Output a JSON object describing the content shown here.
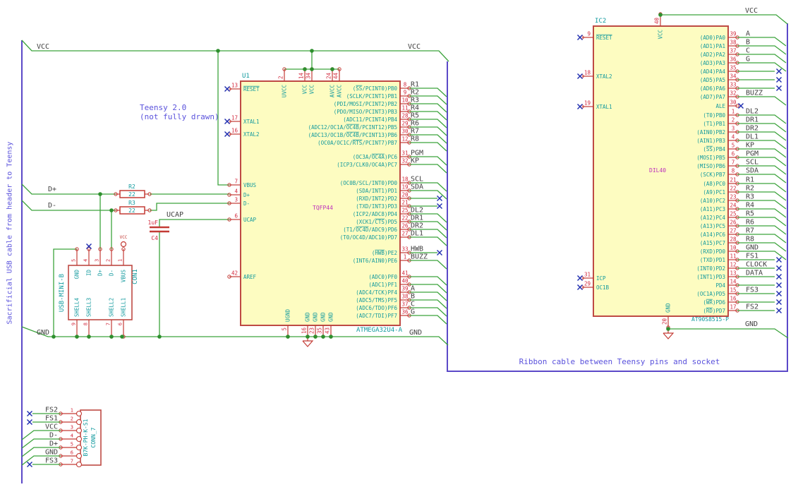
{
  "notes": {
    "cable": "Sacrificial USB cable from header to Teensy",
    "teensy1": "Teensy 2.0",
    "teensy2": "(not fully drawn)",
    "ribbon": "Ribbon cable between Teensy pins and socket"
  },
  "colors": {
    "wire": "#3ca33c",
    "junction": "#2e8f2e",
    "device": "#be4a44",
    "device_fill": "#fdfcc1",
    "pin": "#c33b35",
    "pin_number": "#d2293d",
    "pin_name": "#129a9e",
    "reference": "#129a9e",
    "value": "#129a9e",
    "footprint": "#bc2ebc",
    "label": "#404040",
    "note": "#5a52dc",
    "frame": "#5b49c8",
    "noconnect": "#1f2db0"
  },
  "net_labels": {
    "vcc_left": "VCC",
    "vcc_right": "VCC",
    "gnd_left": "GND",
    "gnd_right": "GND",
    "dplus": "D+",
    "dminus": "D-",
    "ucap": "UCAP",
    "ic2_vcc": "VCC",
    "ic2_gnd": "GND",
    "vcc_flag": "VCC"
  },
  "components": {
    "u1": {
      "ref": "U1",
      "value": "ATMEGA32U4-A",
      "footprint": "TQFP44",
      "left_pins": [
        {
          "num": "13",
          "name": "~RESET~",
          "term": "nc"
        },
        {
          "num": "17",
          "name": "XTAL1",
          "term": "nc"
        },
        {
          "num": "16",
          "name": "XTAL2",
          "term": "nc"
        },
        {
          "num": "7",
          "name": "VBUS",
          "term": "wire"
        },
        {
          "num": "4",
          "name": "D+",
          "term": "wire"
        },
        {
          "num": "3",
          "name": "D-",
          "term": "wire"
        },
        {
          "num": "6",
          "name": "UCAP",
          "term": "wire"
        },
        {
          "num": "42",
          "name": "AREF",
          "term": "open"
        }
      ],
      "top_pins": [
        {
          "num": "2",
          "name": "UVCC"
        },
        {
          "num": "14",
          "name": "VCC"
        },
        {
          "num": "34",
          "name": "VCC"
        },
        {
          "num": "24",
          "name": "AVCC"
        },
        {
          "num": "44",
          "name": "AVCC"
        }
      ],
      "bottom_pins": [
        {
          "num": "5",
          "name": "UGND"
        },
        {
          "num": "16",
          "name": "GND"
        },
        {
          "num": "23",
          "name": "GND"
        },
        {
          "num": "35",
          "name": "GND"
        },
        {
          "num": "43",
          "name": "GND"
        }
      ],
      "right_pins": [
        {
          "num": "8",
          "name": "(~SS~/PCINT0)PB0",
          "net": "R1",
          "term": "bus"
        },
        {
          "num": "9",
          "name": "(SCLK/PCINT1)PB1",
          "net": "R2",
          "term": "bus"
        },
        {
          "num": "10",
          "name": "(PDI/MOSI/PCINT2)PB2",
          "net": "R3",
          "term": "bus"
        },
        {
          "num": "11",
          "name": "(PDO/MISO/PCINT3)PB3",
          "net": "R4",
          "term": "bus"
        },
        {
          "num": "28",
          "name": "(ADC11/PCINT4)PB4",
          "net": "R5",
          "term": "bus"
        },
        {
          "num": "29",
          "name": "(ADC12/OC1A/~OC4B~/PCINT12)PB5",
          "net": "R6",
          "term": "bus"
        },
        {
          "num": "30",
          "name": "(ADC13/OC1B/~OC4B~/PCINT13)PB6",
          "net": "R7",
          "term": "bus"
        },
        {
          "num": "12",
          "name": "(OC0A/OC1C/~RTS~/PCINT7)PB7",
          "net": "R8",
          "term": "bus"
        },
        {
          "num": "31",
          "name": "(OC3A/~OC4A~)PC6",
          "net": "PGM",
          "term": "bus"
        },
        {
          "num": "32",
          "name": "(ICP3/CLK0/OC4A)PC7",
          "net": "KP",
          "term": "bus"
        },
        {
          "num": "18",
          "name": "(OC0B/SCL/INT0)PD0",
          "net": "SCL",
          "term": "bus"
        },
        {
          "num": "19",
          "name": "(SDA/INT1)PD1",
          "net": "SDA",
          "term": "bus"
        },
        {
          "num": "20",
          "name": "(RXD/INT2)PD2",
          "net": "",
          "term": "nc"
        },
        {
          "num": "21",
          "name": "(TXD/INT3)PD3",
          "net": "",
          "term": "nc"
        },
        {
          "num": "25",
          "name": "(ICP2/ADC8)PD4",
          "net": "DL2",
          "term": "bus"
        },
        {
          "num": "22",
          "name": "(XCK1/~CTS~)PD5",
          "net": "DR1",
          "term": "bus"
        },
        {
          "num": "26",
          "name": "(T1/~OC4D~/ADC9)PD6",
          "net": "DR2",
          "term": "bus"
        },
        {
          "num": "27",
          "name": "(T0/OC4D/ADC10)PD7",
          "net": "DL1",
          "term": "bus"
        },
        {
          "num": "33",
          "name": "(~HWB~)PE2",
          "net": "HWB",
          "term": "nc"
        },
        {
          "num": "1",
          "name": "(INT6/AIN0)PE6",
          "net": "BUZZ",
          "term": "bus"
        },
        {
          "num": "41",
          "name": "(ADC0)PF0",
          "net": "",
          "term": "bus"
        },
        {
          "num": "40",
          "name": "(ADC1)PF1",
          "net": "",
          "term": "bus"
        },
        {
          "num": "39",
          "name": "(ADC4/TCK)PF4",
          "net": "A",
          "term": "bus"
        },
        {
          "num": "38",
          "name": "(ADC5/TMS)PF5",
          "net": "B",
          "term": "bus"
        },
        {
          "num": "37",
          "name": "(ADC6/TDO)PF6",
          "net": "C",
          "term": "bus"
        },
        {
          "num": "36",
          "name": "(ADC7/TDI)PF7",
          "net": "G",
          "term": "bus"
        }
      ]
    },
    "ic2": {
      "ref": "IC2",
      "value": "AT90S8515-P",
      "footprint": "DIL40",
      "left_pins": [
        {
          "num": "9",
          "name": "~RESET~",
          "term": "nc"
        },
        {
          "num": "18",
          "name": "XTAL2",
          "term": "nc"
        },
        {
          "num": "19",
          "name": "XTAL1",
          "term": "nc"
        },
        {
          "num": "31",
          "name": "ICP",
          "term": "nc"
        },
        {
          "num": "29",
          "name": "OC1B",
          "term": "nc"
        }
      ],
      "top_pins": [
        {
          "num": "40",
          "name": "VCC"
        }
      ],
      "bottom_pins": [
        {
          "num": "20",
          "name": "GND"
        }
      ],
      "right_pins": [
        {
          "num": "39",
          "name": "(AD0)PA0",
          "net": "A",
          "term": "bus"
        },
        {
          "num": "38",
          "name": "(AD1)PA1",
          "net": "B",
          "term": "bus"
        },
        {
          "num": "37",
          "name": "(AD2)PA2",
          "net": "C",
          "term": "bus"
        },
        {
          "num": "36",
          "name": "(AD3)PA3",
          "net": "G",
          "term": "bus"
        },
        {
          "num": "35",
          "name": "(AD4)PA4",
          "net": "",
          "term": "nc"
        },
        {
          "num": "34",
          "name": "(AD5)PA5",
          "net": "",
          "term": "nc"
        },
        {
          "num": "33",
          "name": "(AD6)PA6",
          "net": "",
          "term": "nc"
        },
        {
          "num": "32",
          "name": "(AD7)PA7",
          "net": "BUZZ",
          "term": "bus"
        },
        {
          "num": "30",
          "name": "ALE",
          "net": "",
          "term": "nc0"
        },
        {
          "num": "1",
          "name": "(T0)PB0",
          "net": "DL2",
          "term": "bus"
        },
        {
          "num": "2",
          "name": "(T1)PB1",
          "net": "DR1",
          "term": "bus"
        },
        {
          "num": "3",
          "name": "(AIN0)PB2",
          "net": "DR2",
          "term": "bus"
        },
        {
          "num": "4",
          "name": "(AIN1)PB3",
          "net": "DL1",
          "term": "bus"
        },
        {
          "num": "5",
          "name": "(~SS~)PB4",
          "net": "KP",
          "term": "bus"
        },
        {
          "num": "6",
          "name": "(MOSI)PB5",
          "net": "PGM",
          "term": "bus"
        },
        {
          "num": "7",
          "name": "(MISO)PB6",
          "net": "SCL",
          "term": "bus"
        },
        {
          "num": "8",
          "name": "(SCK)PB7",
          "net": "SDA",
          "term": "bus"
        },
        {
          "num": "21",
          "name": "(A8)PC0",
          "net": "R1",
          "term": "bus"
        },
        {
          "num": "22",
          "name": "(A9)PC1",
          "net": "R2",
          "term": "bus"
        },
        {
          "num": "23",
          "name": "(A10)PC2",
          "net": "R3",
          "term": "bus"
        },
        {
          "num": "24",
          "name": "(A11)PC3",
          "net": "R4",
          "term": "bus"
        },
        {
          "num": "25",
          "name": "(A12)PC4",
          "net": "R5",
          "term": "bus"
        },
        {
          "num": "26",
          "name": "(A13)PC5",
          "net": "R6",
          "term": "bus"
        },
        {
          "num": "27",
          "name": "(A14)PC6",
          "net": "R7",
          "term": "bus"
        },
        {
          "num": "28",
          "name": "(A15)PC7",
          "net": "R8",
          "term": "bus"
        },
        {
          "num": "10",
          "name": "(RXD)PD0",
          "net": "GND",
          "term": "bus"
        },
        {
          "num": "11",
          "name": "(TXD)PD1",
          "net": "FS1",
          "term": "nc"
        },
        {
          "num": "12",
          "name": "(INT0)PD2",
          "net": "CLOCK",
          "term": "nc"
        },
        {
          "num": "13",
          "name": "(INT1)PD3",
          "net": "DATA",
          "term": "nc"
        },
        {
          "num": "14",
          "name": "PD4",
          "net": "",
          "term": "nc"
        },
        {
          "num": "15",
          "name": "(OC1A)PD5",
          "net": "FS3",
          "term": "nc"
        },
        {
          "num": "16",
          "name": "(~WR~)PD6",
          "net": "",
          "term": "nc"
        },
        {
          "num": "17",
          "name": "(~RD~)PD7",
          "net": "FS2",
          "term": "nc"
        }
      ]
    },
    "con1": {
      "ref": "CON1",
      "value": "USB-MINI-B",
      "top_pins": [
        {
          "num": "5",
          "name": "GND"
        },
        {
          "num": "4",
          "name": "ID"
        },
        {
          "num": "3",
          "name": "D+"
        },
        {
          "num": "2",
          "name": "D-"
        },
        {
          "num": "1",
          "name": "VBUS"
        }
      ],
      "bottom_pins": [
        {
          "num": "9",
          "name": "SHELL4"
        },
        {
          "num": "8",
          "name": "SHELL3"
        },
        {
          "num": "7",
          "name": "SHELL2"
        },
        {
          "num": "6",
          "name": "SHELL1"
        }
      ]
    },
    "conn7": {
      "ref": "CONN_7",
      "value": "B7K-PH-K-S1",
      "pins": [
        {
          "num": "1",
          "net": "FS2",
          "term": "nc"
        },
        {
          "num": "2",
          "net": "FS1",
          "term": "nc"
        },
        {
          "num": "3",
          "net": "VCC",
          "term": "bus"
        },
        {
          "num": "4",
          "net": "D-",
          "term": "bus"
        },
        {
          "num": "5",
          "net": "D+",
          "term": "bus"
        },
        {
          "num": "6",
          "net": "GND",
          "term": "bus"
        },
        {
          "num": "7",
          "net": "FS3",
          "term": "nc"
        }
      ]
    },
    "r2": {
      "ref": "R2",
      "value": "22"
    },
    "r3": {
      "ref": "R3",
      "value": "22"
    },
    "c4": {
      "ref": "C4",
      "value": "1uF"
    }
  }
}
